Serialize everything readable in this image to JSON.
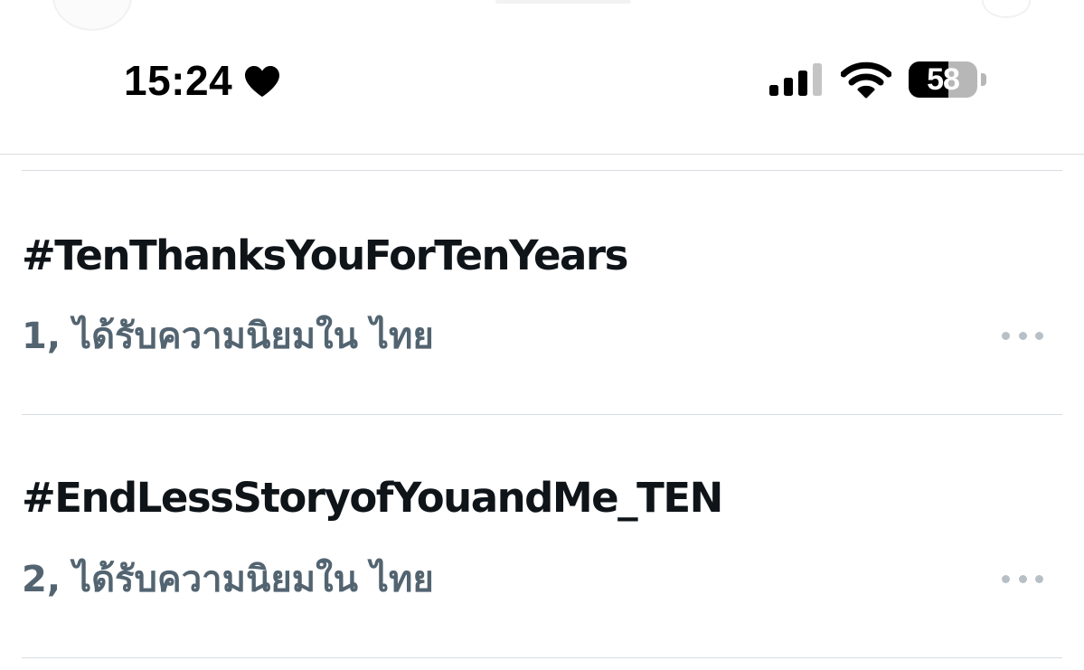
{
  "status_bar": {
    "time": "15:24",
    "heart_icon": "heart-icon",
    "signal_icon": "cellular-signal-icon",
    "signal_bars_filled": 3,
    "signal_bars_total": 4,
    "wifi_icon": "wifi-icon",
    "battery_percent_label": "58",
    "battery_level": 0.58
  },
  "trends": [
    {
      "hashtag": "#TenThanksYouForTenYears",
      "rank": "1",
      "context": ", ได้รับความนิยมใน ไทย",
      "more_icon": "more-horizontal-icon"
    },
    {
      "hashtag": "#EndLessStoryofYouandMe_TEN",
      "rank": "2",
      "context": ", ได้รับความนิยมใน ไทย",
      "more_icon": "more-horizontal-icon"
    }
  ],
  "colors": {
    "primary_text": "#0f1419",
    "secondary_text": "#536471",
    "divider": "#d8dde1",
    "more_dots": "#b7c0c7"
  }
}
